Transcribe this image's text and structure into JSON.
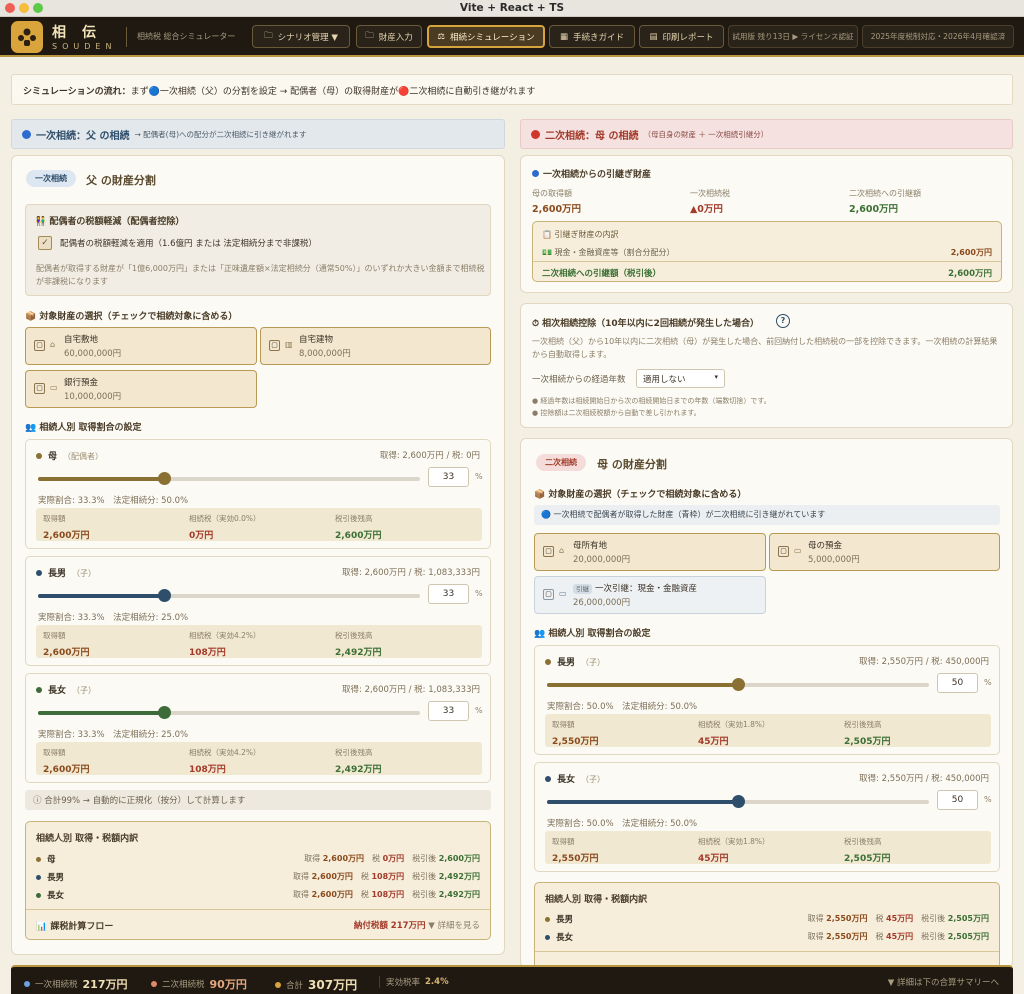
{
  "window": {
    "title": "Vite + React + TS"
  },
  "app": {
    "brand": "相伝",
    "brand_romaji": "SOUDEN",
    "subtitle": "相続税 総合シミュレーター"
  },
  "nav": [
    {
      "label": "シナリオ管理 ▼"
    },
    {
      "label": "財産入力"
    },
    {
      "label": "相続シミュレーション"
    },
    {
      "label": "手続きガイド"
    },
    {
      "label": "印刷レポート"
    },
    {
      "label": "試用版 残り13日 ▶ ライセンス認証"
    },
    {
      "label": "2025年度税制対応・2026年4月確認済"
    }
  ],
  "flow": {
    "label": "シミュレーションの流れ：",
    "text": "まず🔵一次相続（父）の分割を設定 → 配偶者（母）の取得財産が🔴二次相続に自動引き継がれます"
  },
  "first": {
    "header": "一次相続：父 の相続",
    "header_note": "→ 配偶者(母)への配分が二次相続に引き継がれます",
    "badge": "一次相続",
    "title": "父 の財産分割",
    "spouse": {
      "title": "👫 配偶者の税額軽減（配偶者控除）",
      "check_label": "配偶者の税額軽減を適用（1.6億円 または 法定相続分まで非課税）",
      "note": "配偶者が取得する財産が「1億6,000万円」または「正味遺産額×法定相続分（通常50%）」のいずれか大きい金額まで相続税が非課税になります"
    },
    "assets_title": "📦 対象財産の選択（チェックで相続対象に含める）",
    "assets": [
      {
        "name": "自宅敷地",
        "value": "60,000,000円",
        "icon": "🏠"
      },
      {
        "name": "自宅建物",
        "value": "8,000,000円",
        "icon": "🏢"
      },
      {
        "name": "銀行預金",
        "value": "10,000,000円",
        "icon": "💴"
      }
    ],
    "ratio_title": "👥 相続人別 取得割合の設定",
    "heirs": [
      {
        "name": "母",
        "role": "（配偶者）",
        "summary": "取得: 2,600万円 / 税: 0円",
        "ratio": "33",
        "ratio_value": 0.33,
        "color": "#8a7133",
        "actual": "実際割合: 33.3%　法定相続分: 50.0%",
        "acq_label": "取得額",
        "acq": "2,600万円",
        "tax_label": "相続税（実効0.0%）",
        "tax": "0万円",
        "net_label": "税引後残高",
        "net": "2,600万円"
      },
      {
        "name": "長男",
        "role": "（子）",
        "summary": "取得: 2,600万円 / 税: 1,083,333円",
        "ratio": "33",
        "ratio_value": 0.33,
        "color": "#2e4e6b",
        "actual": "実際割合: 33.3%　法定相続分: 25.0%",
        "acq_label": "取得額",
        "acq": "2,600万円",
        "tax_label": "相続税（実効4.2%）",
        "tax": "108万円",
        "net_label": "税引後残高",
        "net": "2,492万円"
      },
      {
        "name": "長女",
        "role": "（子）",
        "summary": "取得: 2,600万円 / 税: 1,083,333円",
        "ratio": "33",
        "ratio_value": 0.33,
        "color": "#3e6b3a",
        "actual": "実際割合: 33.3%　法定相続分: 25.0%",
        "acq_label": "取得額",
        "acq": "2,600万円",
        "tax_label": "相続税（実効4.2%）",
        "tax": "108万円",
        "net_label": "税引後残高",
        "net": "2,492万円"
      }
    ],
    "normalize_note": "ⓘ 合計99% → 自動的に正規化（按分）して計算します",
    "summary": {
      "title": "相続人別 取得・税額内訳",
      "rows": [
        {
          "name": "母",
          "acq": "2,600万円",
          "tax": "0万円",
          "net": "2,600万円"
        },
        {
          "name": "長男",
          "acq": "2,600万円",
          "tax": "108万円",
          "net": "2,492万円"
        },
        {
          "name": "長女",
          "acq": "2,600万円",
          "tax": "108万円",
          "net": "2,492万円"
        }
      ],
      "flow_label": "📊 課税計算フロー",
      "total": "納付税額 217万円",
      "detail": "▼ 詳細を見る"
    }
  },
  "second": {
    "header": "二次相続：母 の相続",
    "header_note": "（母自身の財産 ＋ 一次相続引継分）",
    "carry": {
      "title": "一次相続からの引継ぎ財産",
      "cols": [
        {
          "label": "母の取得額",
          "value": "2,600万円"
        },
        {
          "label": "一次相続税",
          "value": "▲0万円"
        },
        {
          "label": "二次相続への引継額",
          "value": "2,600万円"
        }
      ],
      "box_title": "📋 引継ぎ財産の内訳",
      "box_item": "💵 現金・金融資産等（割合分配分）",
      "box_item_value": "2,600万円",
      "box_total_label": "二次相続への引継額（税引後）",
      "box_total_value": "2,600万円"
    },
    "deduction": {
      "title": "⏱ 相次相続控除（10年以内に2回相続が発生した場合）",
      "text": "一次相続（父）から10年以内に二次相続（母）が発生した場合、前回納付した相続税の一部を控除できます。一次相続の計算結果から自動取得します。",
      "select_label": "一次相続からの経過年数",
      "select_value": "適用しない",
      "note1": "● 経過年数は相続開始日から次の相続開始日までの年数（端数切捨）です。",
      "note2": "● 控除額は二次相続税額から自動で差し引かれます。"
    },
    "badge": "二次相続",
    "title": "母 の財産分割",
    "assets_title": "📦 対象財産の選択（チェックで相続対象に含める）",
    "carry_note": "🔵 一次相続で配偶者が取得した財産（青枠）が二次相続に引き継がれています",
    "assets": [
      {
        "name": "母所有地",
        "value": "20,000,000円"
      },
      {
        "name": "母の預金",
        "value": "5,000,000円"
      }
    ],
    "carried_asset": {
      "tag": "引継",
      "name": "一次引継：現金・金融資産",
      "value": "26,000,000円"
    },
    "ratio_title": "👥 相続人別 取得割合の設定",
    "heirs": [
      {
        "name": "長男",
        "role": "（子）",
        "summary": "取得: 2,550万円 / 税: 450,000円",
        "ratio": "50",
        "ratio_value": 0.5,
        "color": "#8a7133",
        "actual": "実際割合: 50.0%　法定相続分: 50.0%",
        "acq_label": "取得額",
        "acq": "2,550万円",
        "tax_label": "相続税（実効1.8%）",
        "tax": "45万円",
        "net_label": "税引後残高",
        "net": "2,505万円"
      },
      {
        "name": "長女",
        "role": "（子）",
        "summary": "取得: 2,550万円 / 税: 450,000円",
        "ratio": "50",
        "ratio_value": 0.5,
        "color": "#2e4e6b",
        "actual": "実際割合: 50.0%　法定相続分: 50.0%",
        "acq_label": "取得額",
        "acq": "2,550万円",
        "tax_label": "相続税（実効1.8%）",
        "tax": "45万円",
        "net_label": "税引後残高",
        "net": "2,505万円"
      }
    ],
    "summary": {
      "title": "相続人別 取得・税額内訳",
      "rows": [
        {
          "name": "長男",
          "acq": "2,550万円",
          "tax": "45万円",
          "net": "2,505万円"
        },
        {
          "name": "長女",
          "acq": "2,550万円",
          "tax": "45万円",
          "net": "2,505万円"
        }
      ]
    }
  },
  "bottom": {
    "first_label": "一次相続税",
    "first_value": "217万円",
    "second_label": "二次相続税",
    "second_value": "90万円",
    "total_label": "合計",
    "total_value": "307万円",
    "rate_label": "実効税率",
    "rate_value": "2.4%",
    "detail": "▼ 詳細は下の合算サマリーへ"
  },
  "labels": {
    "acq": "取得",
    "tax": "税",
    "net": "税引後",
    "pct": "%"
  },
  "colors": {
    "accent": "#b8953f",
    "dark": "#1f1912",
    "blue_header": "#e3e8ec",
    "red_header": "#f5e2e0",
    "brown_text": "#8a4a1c",
    "green_text": "#3b6f34"
  }
}
